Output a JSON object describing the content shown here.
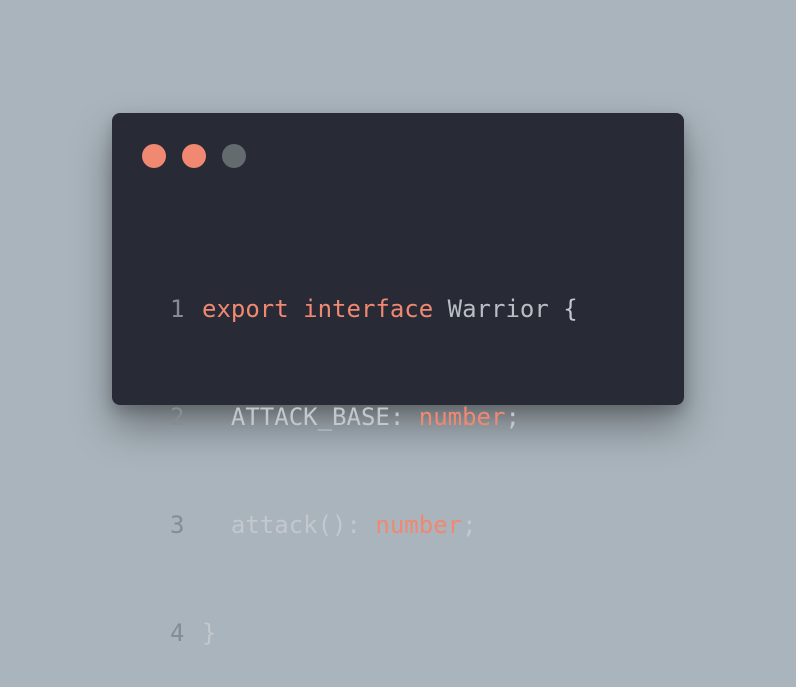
{
  "window": {
    "buttons": [
      "close",
      "minimize",
      "maximize"
    ],
    "colors": {
      "background": "#282a36",
      "page": "#a9b4bc",
      "button_red": "#f08872",
      "button_yellow": "#f08872",
      "button_gray": "#646b6f"
    }
  },
  "code": {
    "lines": [
      {
        "num": "1",
        "tokens": [
          "export",
          "interface",
          "Warrior",
          "{"
        ]
      },
      {
        "num": "2",
        "tokens": [
          "ATTACK_BASE:",
          "number",
          ";"
        ]
      },
      {
        "num": "3",
        "tokens": [
          "attack():",
          "number",
          ";"
        ]
      },
      {
        "num": "4",
        "tokens": [
          "}"
        ]
      }
    ]
  }
}
